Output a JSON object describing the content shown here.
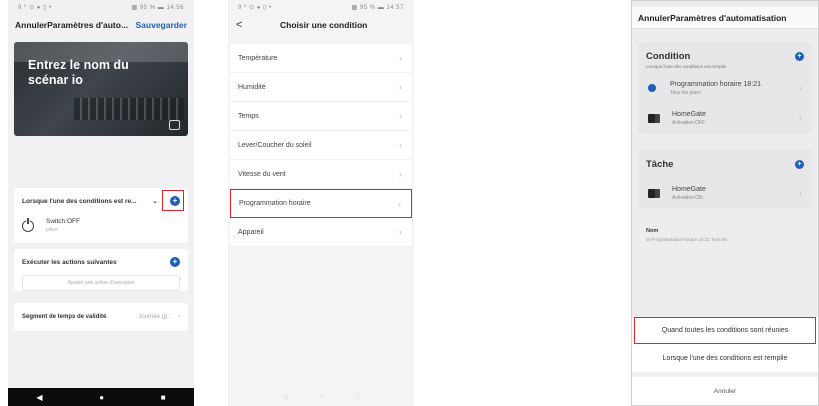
{
  "phone1": {
    "status_left": "9 ⁰ ⊙ ● ▯ •",
    "status_right": "▩ 95 % ▬ 14:56",
    "header_left": "AnnulerParamètres d'auto...",
    "header_right": "Sauvegarder",
    "hero_title": "Entrez le nom du scénar io",
    "condition_header": "Lorsque l'une des conditions est re...",
    "condition_item_title": "Switch:OFF",
    "condition_item_sub": "pièce",
    "actions_header": "Exécuter les actions suivantes",
    "add_action": "Ajouter une action d'exécution",
    "segment_label": "Segment de temps de validité",
    "segment_value": "Journée (p...",
    "nav": [
      "◀",
      "●",
      "■"
    ]
  },
  "phone2": {
    "status_left": "9 ⁰ ⊙ ● ▯ •",
    "status_right": "▩ 95 % ▬ 14:57",
    "back": "<",
    "title": "Choisir une condition",
    "items": [
      "Température",
      "Humidité",
      "Temps",
      "Lever/Coucher du soleil",
      "Vitesse du vent",
      "Programmation horaire",
      "Appareil"
    ],
    "highlighted_item": "Programmation horaire",
    "nav": [
      "◁",
      "○",
      "□"
    ]
  },
  "phone3": {
    "header": "AnnulerParamètres d'automatisation",
    "condition_title": "Condition",
    "condition_sub": "Lorsque l'une des conditions est remplie",
    "cond_items": [
      {
        "title": "Programmation horaire 18:21",
        "sub": "Tous les jours"
      },
      {
        "title": "HomeGate",
        "sub": "Activation:OFF"
      }
    ],
    "tache_title": "Tâche",
    "tache_items": [
      {
        "title": "HomeGate",
        "sub": "Activation:ON"
      }
    ],
    "nom_label": "Nom",
    "nom_value": "Si Programmation horaire 18:21 Tous les",
    "sheet_options": [
      "Quand toutes les conditions sont réunies",
      "Lorsque l'une des conditions est remplie"
    ],
    "sheet_cancel": "Annuler"
  },
  "colors": {
    "accent_blue": "#1f5fb8",
    "highlight_red": "#e0262a"
  }
}
